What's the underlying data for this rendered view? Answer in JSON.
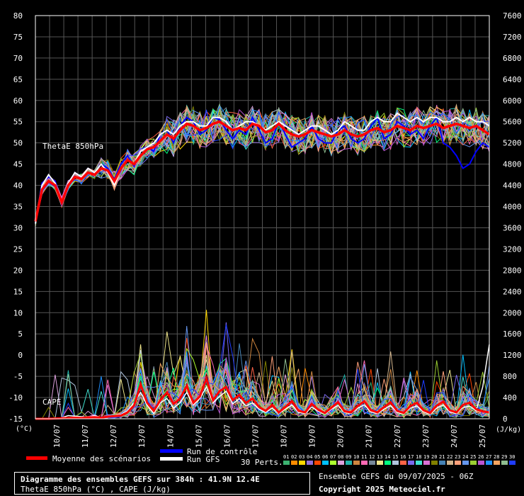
{
  "footer": {
    "title_line": "Diagramme des ensembles GEFS sur 384h : 41.9N 12.4E",
    "subtitle_line": "ThetaE 850hPa (°C) , CAPE (J/kg)",
    "ensemble_info": "Ensemble GEFS du 09/07/2025 - 06Z",
    "copyright": "Copyright 2025 Meteociel.fr"
  },
  "legend": {
    "mean_label": "Moyenne des scénarios",
    "control_label": "Run de contrôle",
    "gfs_label": "Run GFS",
    "perts_label": "30 Perts.",
    "pert_numbers": [
      "01",
      "02",
      "03",
      "04",
      "05",
      "06",
      "07",
      "08",
      "09",
      "10",
      "11",
      "12",
      "13",
      "14",
      "15",
      "16",
      "17",
      "18",
      "19",
      "20",
      "21",
      "22",
      "23",
      "24",
      "25",
      "26",
      "27",
      "28",
      "29",
      "30"
    ],
    "pert_colors": [
      "#3cb371",
      "#ff8c00",
      "#ffd700",
      "#9370db",
      "#ff4500",
      "#00bfff",
      "#adff2f",
      "#dda0dd",
      "#20b2aa",
      "#cd853f",
      "#ff69b4",
      "#778899",
      "#f0e68c",
      "#00ff7f",
      "#b0c4de",
      "#ff6347",
      "#7b68ee",
      "#40e0d0",
      "#da70d6",
      "#808000",
      "#4682b4",
      "#d2b48c",
      "#ffa07a",
      "#6495ed",
      "#9acd32",
      "#ba55d3",
      "#1e90ff",
      "#f4a460",
      "#8fbc8f",
      "#1f3cff"
    ],
    "mean_color": "#ff0000",
    "control_color": "#0000ff",
    "gfs_color": "#ffffff"
  },
  "chart_data": {
    "type": "line",
    "left_axis": {
      "unit": "(°C)",
      "ticks": [
        80,
        75,
        70,
        65,
        60,
        55,
        50,
        45,
        40,
        35,
        30,
        25,
        20,
        15,
        10,
        5,
        0,
        -5,
        -10,
        -15
      ],
      "range": [
        -15,
        80
      ]
    },
    "right_axis": {
      "unit": "(J/kg)",
      "ticks": [
        7600,
        7200,
        6800,
        6400,
        6000,
        5600,
        5200,
        4800,
        4400,
        4000,
        3600,
        3200,
        2800,
        2400,
        2000,
        1600,
        1200,
        800,
        400,
        0
      ],
      "range": [
        0,
        7600
      ]
    },
    "x_ticks": [
      "10/07",
      "11/07",
      "12/07",
      "13/07",
      "14/07",
      "15/07",
      "16/07",
      "17/07",
      "18/07",
      "19/07",
      "20/07",
      "21/07",
      "22/07",
      "23/07",
      "24/07",
      "25/07"
    ],
    "x_range_hours": [
      0,
      384
    ],
    "label_thetae": "ThetaE 850hPa",
    "label_cape": "CAPE",
    "thetae_mean": [
      31.5,
      39,
      41,
      40,
      36,
      40,
      42,
      41.5,
      43,
      42.5,
      44,
      43.5,
      41,
      44,
      46,
      45,
      47,
      48.5,
      49,
      50.5,
      52,
      51,
      53,
      54.5,
      54,
      53,
      53.5,
      54.5,
      55,
      54,
      53,
      53.5,
      53,
      54.5,
      54,
      52.5,
      53,
      54.5,
      53,
      52,
      51.5,
      52,
      53,
      52.5,
      52,
      51.5,
      52,
      53,
      52,
      51.5,
      52,
      53,
      53.5,
      52.5,
      53,
      54,
      53.5,
      53,
      54,
      53.5,
      54,
      54.5,
      53.5,
      54,
      54.5,
      54,
      53.5,
      54,
      53,
      52
    ],
    "thetae_control": [
      31,
      40.5,
      42,
      41,
      35.5,
      40,
      43,
      42,
      44,
      43,
      45,
      44,
      41.5,
      45,
      47,
      44.5,
      48,
      49,
      48,
      52,
      53,
      50,
      54,
      56,
      55,
      52,
      53,
      56,
      55.5,
      53,
      51,
      53,
      52,
      56,
      53,
      50,
      51,
      55,
      52,
      49,
      50,
      51,
      54,
      51,
      50,
      50,
      53,
      54,
      51,
      50,
      51,
      54,
      56,
      51,
      52,
      55,
      54,
      52,
      53,
      51,
      54,
      56,
      50,
      49,
      47,
      44,
      45,
      48,
      50,
      49
    ],
    "thetae_gfs": [
      31,
      40,
      42.5,
      40.5,
      36,
      40.5,
      43,
      42,
      44,
      43,
      45,
      43,
      40,
      44,
      46,
      45,
      48,
      49,
      50,
      52,
      53,
      52,
      54,
      55,
      55,
      54,
      54,
      56,
      56,
      55,
      53,
      54,
      55,
      55,
      54,
      53,
      54,
      55,
      54,
      53,
      52,
      53,
      54,
      54,
      53,
      52,
      53,
      55,
      54,
      53,
      53,
      55,
      56,
      55,
      55,
      57,
      56,
      55,
      56,
      55,
      56,
      56,
      55,
      55,
      56,
      55,
      56,
      55,
      55,
      54
    ],
    "cape_mean": [
      0,
      0,
      0,
      5,
      10,
      15,
      20,
      15,
      25,
      30,
      20,
      40,
      50,
      60,
      120,
      250,
      650,
      300,
      150,
      350,
      500,
      280,
      380,
      620,
      300,
      420,
      760,
      350,
      520,
      600,
      350,
      450,
      300,
      380,
      220,
      150,
      260,
      120,
      220,
      330,
      150,
      120,
      280,
      170,
      110,
      210,
      310,
      140,
      120,
      240,
      330,
      160,
      120,
      220,
      310,
      150,
      110,
      240,
      300,
      160,
      110,
      250,
      320,
      160,
      120,
      260,
      300,
      180,
      140,
      120
    ],
    "cape_gfs": [
      0,
      0,
      0,
      0,
      20,
      60,
      50,
      40,
      30,
      60,
      20,
      50,
      60,
      80,
      150,
      300,
      500,
      250,
      100,
      300,
      380,
      200,
      300,
      500,
      260,
      380,
      600,
      300,
      420,
      520,
      280,
      380,
      240,
      300,
      180,
      120,
      200,
      100,
      180,
      260,
      120,
      100,
      220,
      140,
      90,
      180,
      250,
      120,
      100,
      200,
      260,
      130,
      100,
      180,
      250,
      120,
      90,
      200,
      240,
      130,
      90,
      200,
      260,
      130,
      100,
      210,
      240,
      150,
      600,
      1400
    ]
  }
}
